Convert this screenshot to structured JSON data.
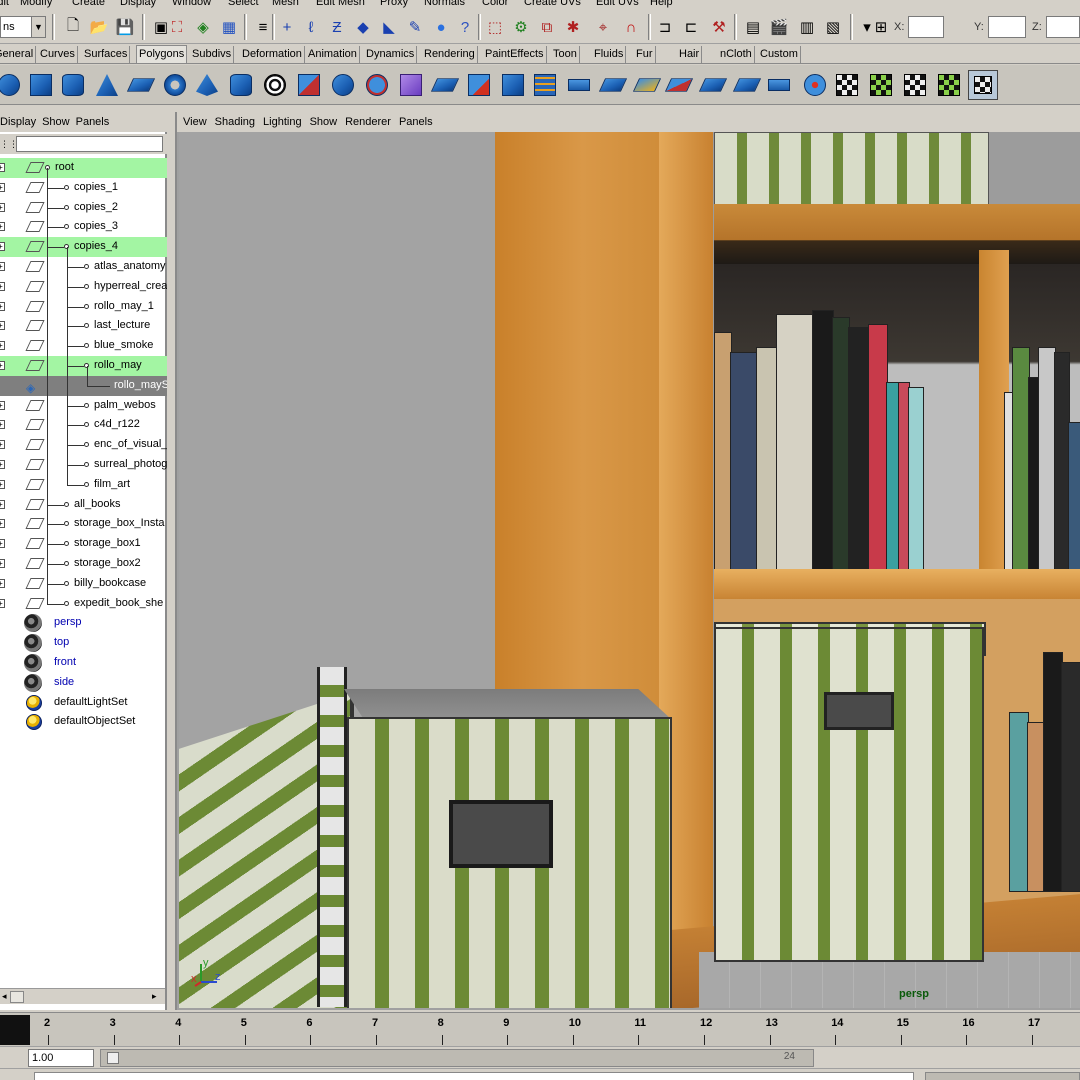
{
  "menubar": [
    "Edit",
    "Modify",
    "Create",
    "Display",
    "Window",
    "Select",
    "Mesh",
    "Edit Mesh",
    "Proxy",
    "Normals",
    "Color",
    "Create UVs",
    "Edit UVs",
    "Help"
  ],
  "toolline": {
    "mode_select": "ns",
    "coords": {
      "x_label": "X:",
      "y_label": "Y:",
      "z_label": "Z:"
    }
  },
  "shelf_tabs": [
    "General",
    "Curves",
    "Surfaces",
    "Polygons",
    "Subdivs",
    "Deformation",
    "Animation",
    "Dynamics",
    "Rendering",
    "PaintEffects",
    "Toon",
    "Fluids",
    "Fur",
    "Hair",
    "nCloth",
    "Custom"
  ],
  "active_shelf_tab": "Polygons",
  "outliner": {
    "menu": [
      "Display",
      "Show",
      "Panels"
    ],
    "items": [
      {
        "name": "root",
        "hl": true
      },
      {
        "name": "copies_1"
      },
      {
        "name": "copies_2"
      },
      {
        "name": "copies_3"
      },
      {
        "name": "copies_4",
        "hl": true
      },
      {
        "name": "atlas_anatomy"
      },
      {
        "name": "hyperreal_crea"
      },
      {
        "name": "rollo_may_1"
      },
      {
        "name": "last_lecture"
      },
      {
        "name": "blue_smoke"
      },
      {
        "name": "rollo_may",
        "hl": true
      },
      {
        "name": "rollo_mayS",
        "sel": true
      },
      {
        "name": "palm_webos"
      },
      {
        "name": "c4d_r122"
      },
      {
        "name": "enc_of_visual_"
      },
      {
        "name": "surreal_photog"
      },
      {
        "name": "film_art"
      },
      {
        "name": "all_books"
      },
      {
        "name": "storage_box_Insta"
      },
      {
        "name": "storage_box1"
      },
      {
        "name": "storage_box2"
      },
      {
        "name": "billy_bookcase"
      },
      {
        "name": "expedit_book_she"
      },
      {
        "name": "persp"
      },
      {
        "name": "top"
      },
      {
        "name": "front"
      },
      {
        "name": "side"
      },
      {
        "name": "defaultLightSet"
      },
      {
        "name": "defaultObjectSet"
      }
    ]
  },
  "viewport": {
    "menu": [
      "View",
      "Shading",
      "Lighting",
      "Show",
      "Renderer",
      "Panels"
    ],
    "camera_label": "persp",
    "axis_y": "y",
    "axis_z": "z",
    "axis_x": "x"
  },
  "timeline": {
    "frames": [
      "2",
      "3",
      "4",
      "5",
      "6",
      "7",
      "8",
      "9",
      "10",
      "11",
      "12",
      "13",
      "14",
      "15",
      "16",
      "17"
    ],
    "start_field": "1.00",
    "range_end": "24"
  },
  "colors": {
    "outliner_highlight": "#a3f5a3",
    "shelf_blue": "#1b5fb3",
    "wood": "#d99848",
    "box_green": "#6c8a35"
  }
}
